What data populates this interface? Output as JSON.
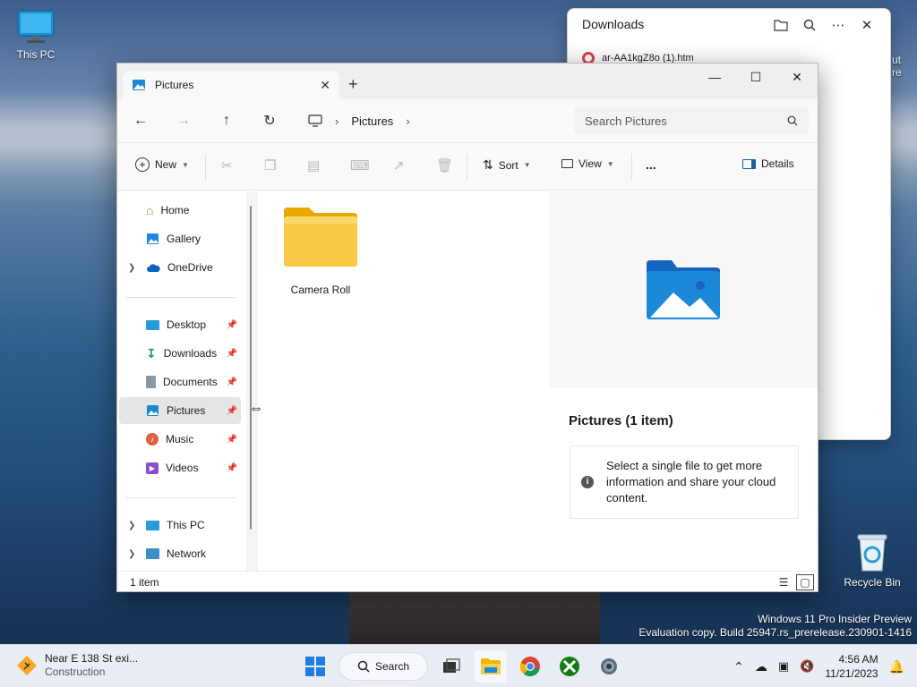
{
  "desktop": {
    "this_pc_label": "This PC",
    "recycle_bin_label": "Recycle Bin",
    "partial_label_1": "ut",
    "partial_label_2": "re"
  },
  "downloads_panel": {
    "title": "Downloads",
    "item_name": "ar-AA1kgZ8o (1).htm"
  },
  "explorer": {
    "tab_title": "Pictures",
    "breadcrumb": [
      "Pictures"
    ],
    "search_placeholder": "Search Pictures",
    "commands": {
      "new_label": "New",
      "sort_label": "Sort",
      "view_label": "View",
      "more_label": "...",
      "details_label": "Details"
    },
    "sidebar": {
      "top": [
        {
          "label": "Home"
        },
        {
          "label": "Gallery"
        },
        {
          "label": "OneDrive"
        }
      ],
      "pinned": [
        {
          "label": "Desktop"
        },
        {
          "label": "Downloads"
        },
        {
          "label": "Documents"
        },
        {
          "label": "Pictures"
        },
        {
          "label": "Music"
        },
        {
          "label": "Videos"
        }
      ],
      "bottom": [
        {
          "label": "This PC"
        },
        {
          "label": "Network"
        }
      ]
    },
    "items": [
      {
        "name": "Camera Roll"
      }
    ],
    "details": {
      "title": "Pictures (1 item)",
      "info_text": "Select a single file to get more information and share your cloud content."
    },
    "status": "1 item"
  },
  "watermark": {
    "line1": "Windows 11 Pro Insider Preview",
    "line2": "Evaluation copy. Build 25947.rs_prerelease.230901-1416"
  },
  "taskbar": {
    "widget_title": "Near E 138 St exi...",
    "widget_sub": "Construction",
    "search_label": "Search",
    "time": "4:56 AM",
    "date": "11/21/2023"
  },
  "colors": {
    "accent": "#0067c0",
    "folder_yellow": "#f8c945",
    "selection": "#e5e5e5"
  }
}
